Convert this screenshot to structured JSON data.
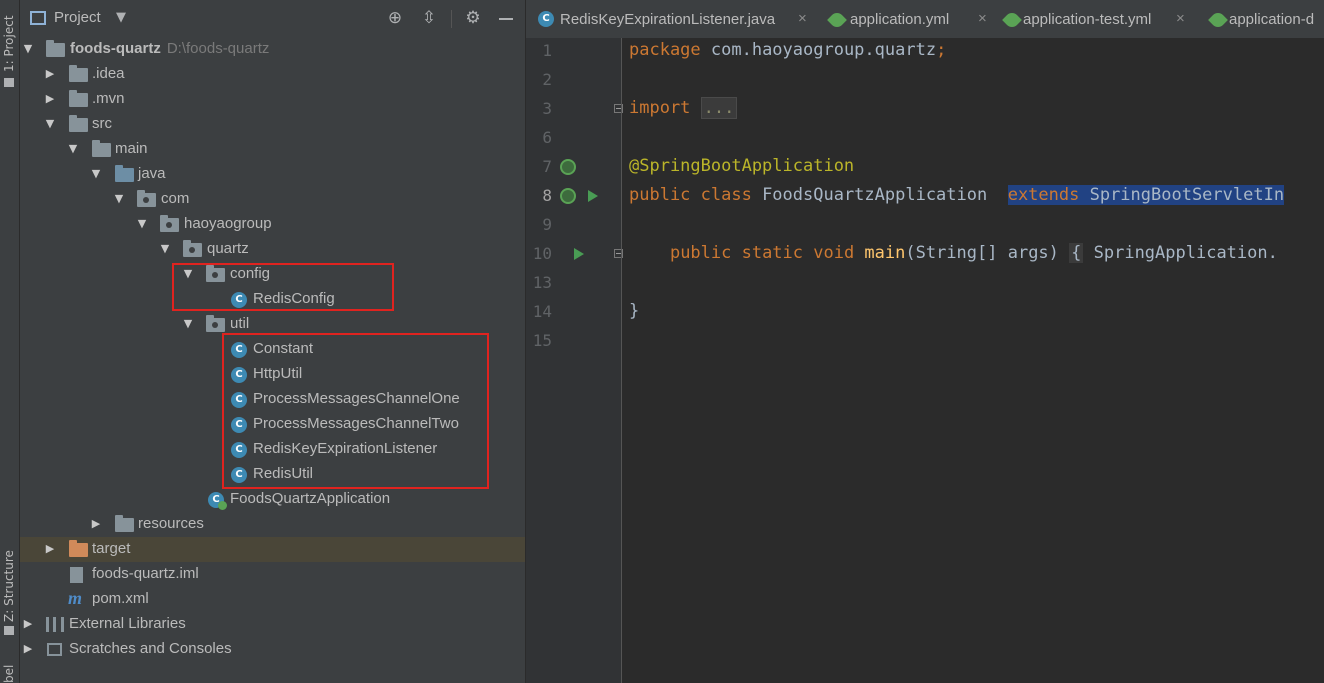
{
  "left_strip": {
    "project_tab": "1: Project",
    "structure_tab": "Z: Structure",
    "bottom_tab": "bel"
  },
  "project_panel": {
    "title": "Project",
    "tree": [
      {
        "label": "foods-quartz",
        "path": "D:\\foods-quartz",
        "type": "module",
        "expanded": true
      },
      {
        "label": ".idea",
        "type": "folder",
        "expanded": false
      },
      {
        "label": ".mvn",
        "type": "folder",
        "expanded": false
      },
      {
        "label": "src",
        "type": "folder",
        "expanded": true
      },
      {
        "label": "main",
        "type": "folder",
        "expanded": true
      },
      {
        "label": "java",
        "type": "source-folder",
        "expanded": true
      },
      {
        "label": "com",
        "type": "package",
        "expanded": true
      },
      {
        "label": "haoyaogroup",
        "type": "package",
        "expanded": true
      },
      {
        "label": "quartz",
        "type": "package",
        "expanded": true
      },
      {
        "label": "config",
        "type": "package",
        "expanded": true
      },
      {
        "label": "RedisConfig",
        "type": "class"
      },
      {
        "label": "util",
        "type": "package",
        "expanded": true
      },
      {
        "label": "Constant",
        "type": "class"
      },
      {
        "label": "HttpUtil",
        "type": "class"
      },
      {
        "label": "ProcessMessagesChannelOne",
        "type": "class"
      },
      {
        "label": "ProcessMessagesChannelTwo",
        "type": "class"
      },
      {
        "label": "RedisKeyExpirationListener",
        "type": "class"
      },
      {
        "label": "RedisUtil",
        "type": "class"
      },
      {
        "label": "FoodsQuartzApplication",
        "type": "spring-class"
      },
      {
        "label": "resources",
        "type": "resources-folder",
        "expanded": false
      },
      {
        "label": "target",
        "type": "excluded-folder",
        "expanded": false
      },
      {
        "label": "foods-quartz.iml",
        "type": "iml-file"
      },
      {
        "label": "pom.xml",
        "type": "maven-file"
      },
      {
        "label": "External Libraries",
        "type": "libraries",
        "expanded": false
      },
      {
        "label": "Scratches and Consoles",
        "type": "scratches",
        "expanded": false
      }
    ]
  },
  "editor": {
    "tabs": [
      {
        "label": "RedisKeyExpirationListener.java",
        "icon": "class-icon",
        "closable": true
      },
      {
        "label": "application.yml",
        "icon": "spring-leaf-icon",
        "closable": true
      },
      {
        "label": "application-test.yml",
        "icon": "spring-leaf-icon",
        "closable": true
      },
      {
        "label": "application-d",
        "icon": "spring-leaf-icon",
        "closable": false
      }
    ],
    "line_numbers": [
      "1",
      "2",
      "3",
      "6",
      "7",
      "8",
      "9",
      "10",
      "13",
      "14",
      "15"
    ],
    "code": {
      "package_kw": "package",
      "package_name": " com.haoyaogroup.quartz",
      "semicolon": ";",
      "import_kw": "import",
      "import_fold": "...",
      "annotation": "@SpringBootApplication",
      "class_decl_kw": "public class",
      "class_name": " FoodsQuartzApplication  ",
      "extends_kw": "extends",
      "superclass": " SpringBootServletIn",
      "method_kw": "public static void",
      "method_name": " main",
      "method_params": "(String[] args) ",
      "fold_open": "{",
      "method_body": " SpringApplication.",
      "closing_brace": "}"
    }
  },
  "colors": {
    "keyword": "#cc7832",
    "annotation": "#bbb529",
    "method": "#ffc66d",
    "selection": "#214283",
    "red_highlight": "#e0231f"
  }
}
